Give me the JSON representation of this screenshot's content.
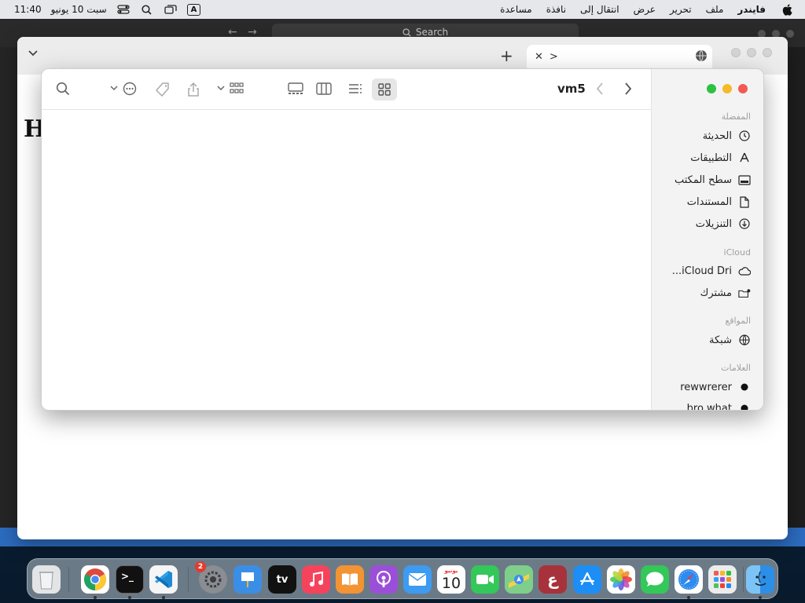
{
  "menubar": {
    "time": "11:40",
    "date": "سبت 10 يونيو",
    "input_badge": "A",
    "app_name": "فايندر",
    "menus": [
      "ملف",
      "تحرير",
      "عرض",
      "انتقال إلى",
      "نافذة",
      "مساعدة"
    ]
  },
  "ide": {
    "search_placeholder": "Search"
  },
  "browser": {
    "tab_prompt": ">",
    "page_heading": "H"
  },
  "finder": {
    "title": "vm5",
    "sidebar": {
      "favorites_heading": "المفضلة",
      "favorites": [
        "الحديثة",
        "التطبيقات",
        "سطح المكتب",
        "المستندات",
        "التنزيلات"
      ],
      "icloud_heading": "iCloud",
      "icloud": [
        "iCloud Dri...",
        "مشترك"
      ],
      "locations_heading": "المواقع",
      "locations": [
        "شبكة"
      ],
      "tags_heading": "العلامات",
      "tags": [
        "rewwrerer",
        "bro what"
      ]
    }
  },
  "dock": {
    "calendar_month": "يونيو",
    "calendar_day": "10",
    "settings_badge": "2",
    "tv_label": "tv",
    "dictionary_glyph": "ع"
  }
}
